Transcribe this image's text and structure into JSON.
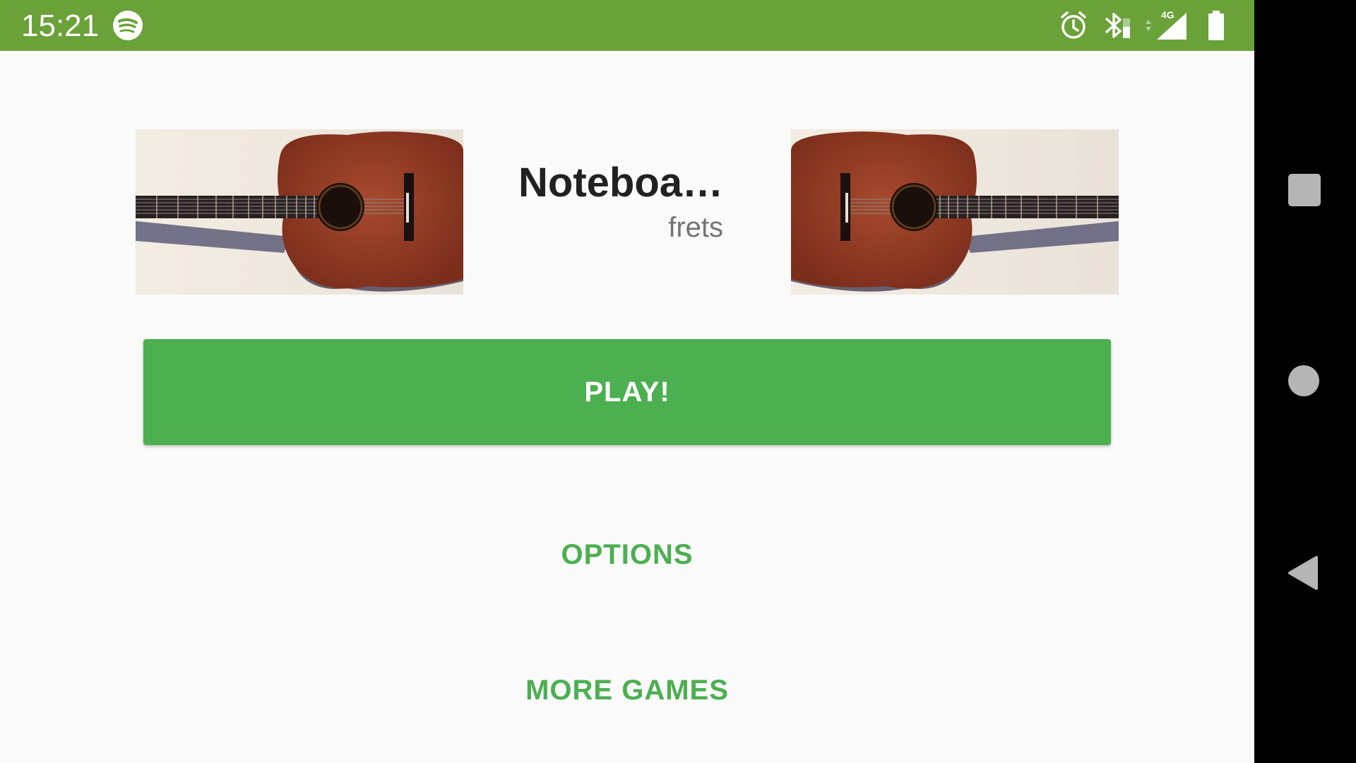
{
  "status_bar": {
    "time": "15:21",
    "color": "#6aa138",
    "icons": [
      "spotify-icon",
      "alarm-icon",
      "bluetooth-icon",
      "network-4g-icon",
      "signal-icon",
      "battery-icon"
    ],
    "network_label": "4G"
  },
  "header": {
    "title": "Noteboa…",
    "subtitle": "frets"
  },
  "buttons": {
    "play_label": "PLAY!",
    "options_label": "OPTIONS",
    "more_games_label": "MORE GAMES"
  },
  "colors": {
    "accent": "#4caf50",
    "status_bar": "#6aa138",
    "nav_bar": "#000000"
  },
  "nav_bar": {
    "icons": [
      "recents-icon",
      "home-icon",
      "back-icon"
    ]
  }
}
